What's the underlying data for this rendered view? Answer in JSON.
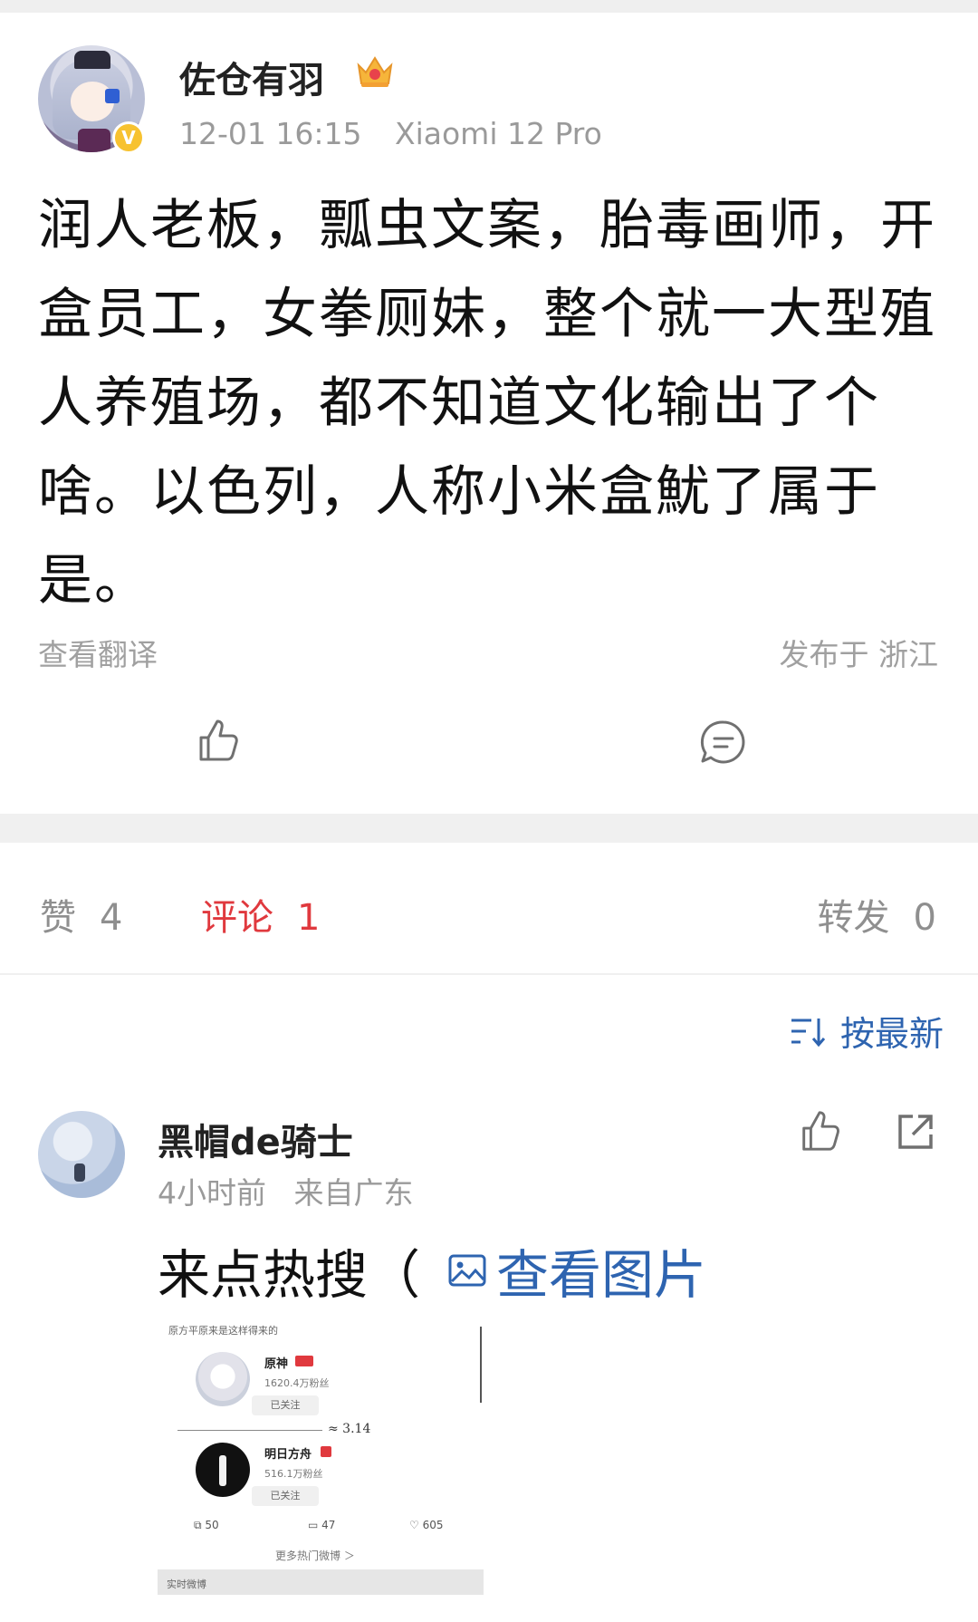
{
  "post": {
    "username": "佐仓有羽",
    "time": "12-01 16:15",
    "device": "Xiaomi 12 Pro",
    "text": "润人老板，瓢虫文案，胎毒画师，开盒员工，女拳厕妹，整个就一大型殖人养殖场，都不知道文化输出了个啥。以色列，人称小米盒魷了属于是。",
    "translate": "查看翻译",
    "location": "发布于 浙江",
    "badge": "V"
  },
  "stats": {
    "like_label": "赞",
    "like_count": "4",
    "comment_label": "评论",
    "comment_count": "1",
    "repost_label": "转发",
    "repost_count": "0"
  },
  "sort": {
    "label": "按最新"
  },
  "comment": {
    "username": "黑帽de骑士",
    "time": "4小时前",
    "source": "来自广东",
    "text": "来点热搜（",
    "link": "查看图片"
  },
  "thumb": {
    "cut_text": "原方平原来是这样得来的",
    "acc1_name": "原神",
    "acc1_fans": "1620.4万粉丝",
    "acc1_btn": "已关注",
    "approx": "≈ 3.14",
    "acc2_name": "明日方舟",
    "acc2_fans": "516.1万粉丝",
    "acc2_btn": "已关注",
    "reposts": "50",
    "comments": "47",
    "likes": "605",
    "more": "更多热门微博 ＞",
    "bar": "实时微博"
  },
  "colors": {
    "accent_red": "#e0393e",
    "link_blue": "#2e64b0",
    "muted": "#9a9a9a"
  }
}
